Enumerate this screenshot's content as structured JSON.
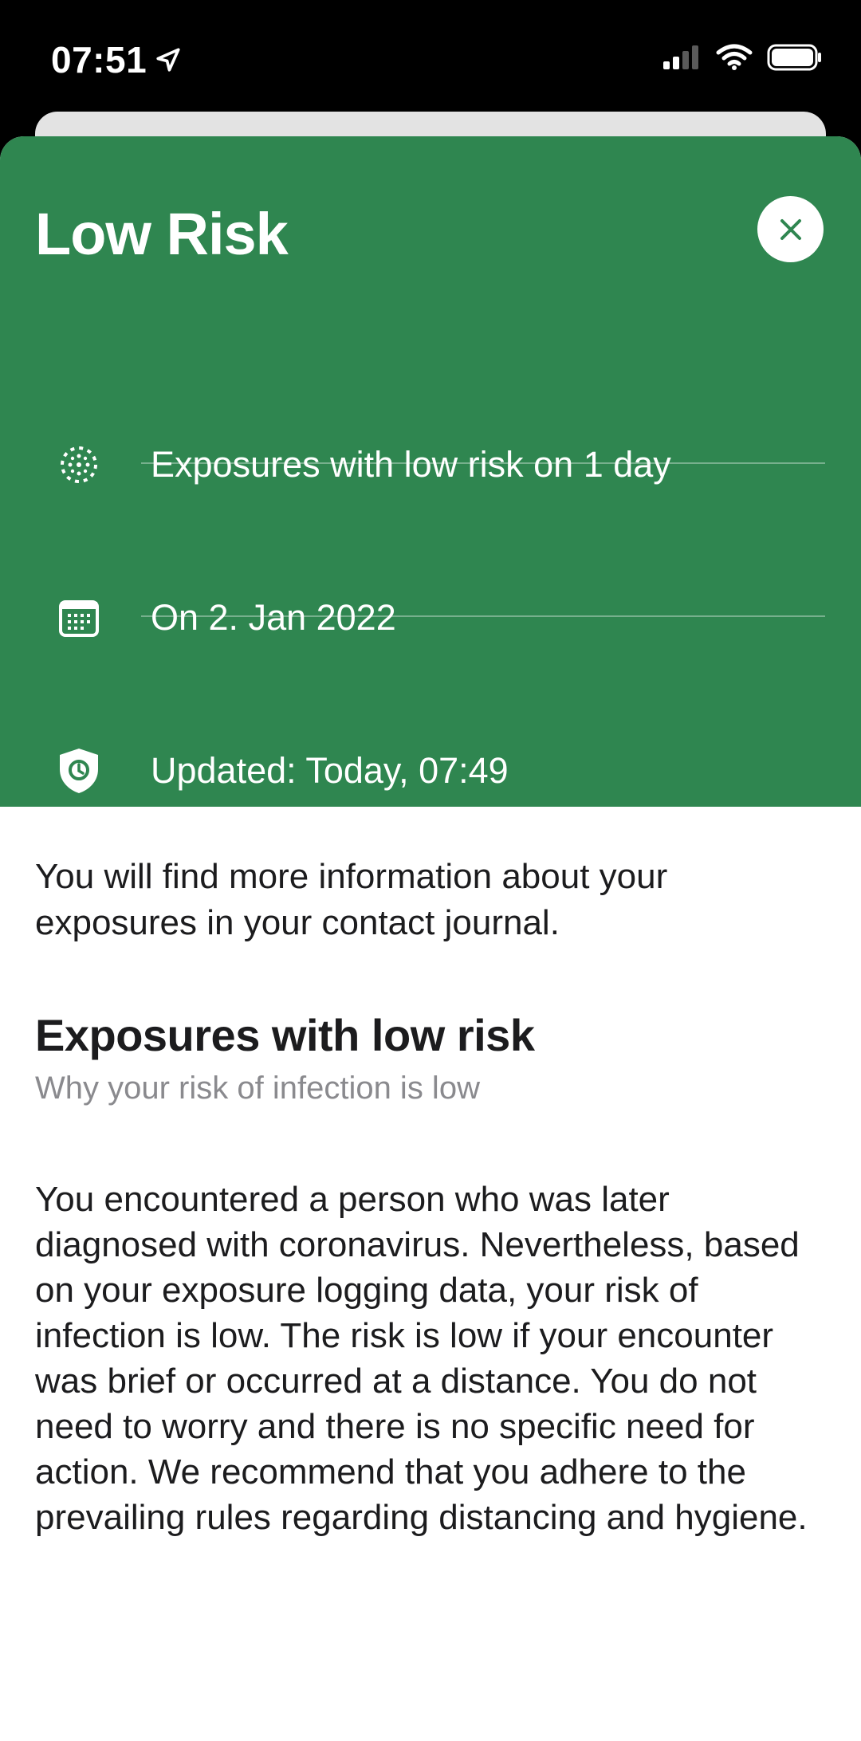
{
  "status_bar": {
    "time": "07:51",
    "icons": [
      "location-arrow-icon",
      "signal-icon",
      "wifi-icon",
      "battery-icon"
    ]
  },
  "header": {
    "title": "Low Risk",
    "background_color": "#2f8650",
    "close_icon": "close-icon"
  },
  "info_rows": [
    {
      "icon": "virus-icon",
      "label": "Exposures with low risk on 1 day"
    },
    {
      "icon": "calendar-icon",
      "label": "On 2. Jan 2022"
    },
    {
      "icon": "shield-clock-icon",
      "label": "Updated: Today, 07:49"
    }
  ],
  "content": {
    "intro": "You will find more information about your exposures in your contact journal.",
    "section_title": "Exposures with low risk",
    "section_subtitle": "Why your risk of infection is low",
    "body": "You encountered a person who was later diagnosed with coronavirus. Nevertheless, based on your exposure logging data, your risk of infection is low. The risk is low if your encounter was brief or occurred at a distance. You do not need to worry and there is no specific need for action. We recommend that you adhere to the prevailing rules regarding distancing and hygiene."
  }
}
